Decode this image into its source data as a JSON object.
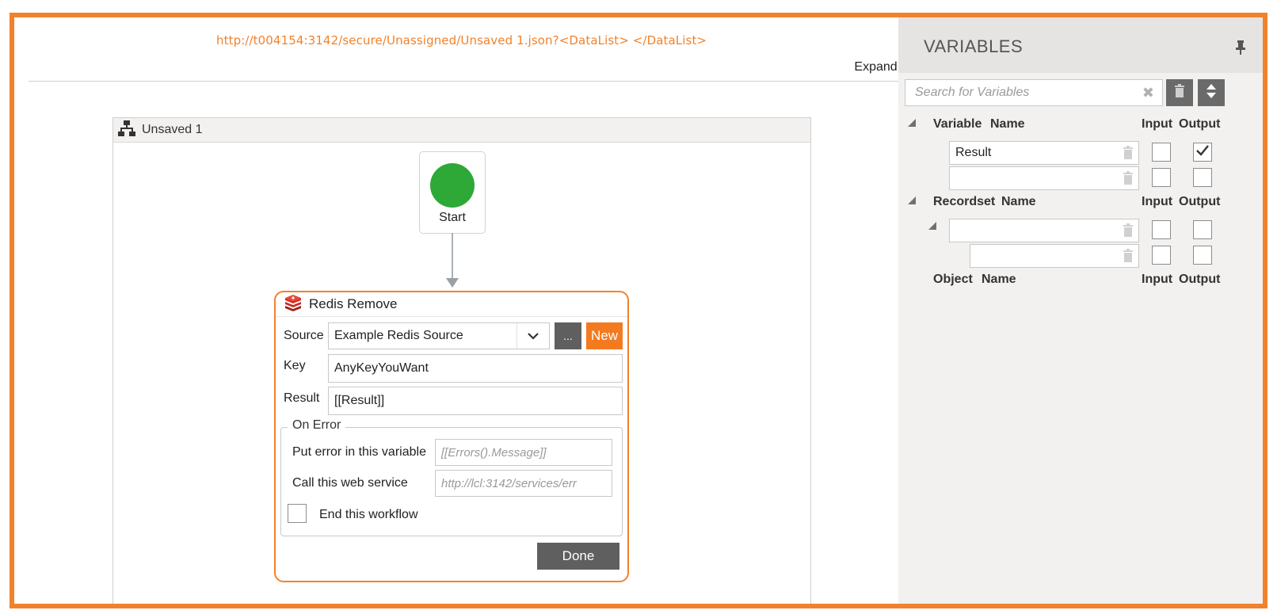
{
  "designer": {
    "url": "http://t004154:3142/secure/Unassigned/Unsaved 1.json?<DataList> </DataList>",
    "expand_all": "Expand All",
    "workflow_name": "Unsaved 1",
    "start_label": "Start"
  },
  "tool": {
    "title": "Redis Remove",
    "source_label": "Source",
    "source_value": "Example Redis Source",
    "dots_label": "...",
    "new_label": "New",
    "key_label": "Key",
    "key_value": "AnyKeyYouWant",
    "result_label": "Result",
    "result_value": "[[Result]]",
    "on_error": {
      "legend": "On Error",
      "error_var_label": "Put error in this variable",
      "error_var_placeholder": "[[Errors().Message]]",
      "web_service_label": "Call this web service",
      "web_service_placeholder": "http://lcl:3142/services/err",
      "end_workflow_label": "End this workflow",
      "end_workflow_checked": false
    },
    "done_label": "Done"
  },
  "variables": {
    "title": "VARIABLES",
    "search_placeholder": "Search for Variables",
    "variable_section": {
      "col1": "Variable",
      "col2": "Name",
      "input": "Input",
      "output": "Output",
      "rows": [
        {
          "name": "Result",
          "input": false,
          "output": true
        },
        {
          "name": "",
          "input": false,
          "output": false
        }
      ]
    },
    "recordset_section": {
      "col1": "Recordset",
      "col2": "Name",
      "input": "Input",
      "output": "Output",
      "rows": [
        {
          "name": "",
          "input": false,
          "output": false
        },
        {
          "name": "",
          "input": false,
          "output": false
        }
      ]
    },
    "object_section": {
      "col1": "Object",
      "col2": "Name",
      "input": "Input",
      "output": "Output"
    }
  },
  "colors": {
    "accent": "#f0822e",
    "start_node": "#2ea836",
    "new_button": "#f47a20",
    "dark_button": "#5f5f5f"
  }
}
